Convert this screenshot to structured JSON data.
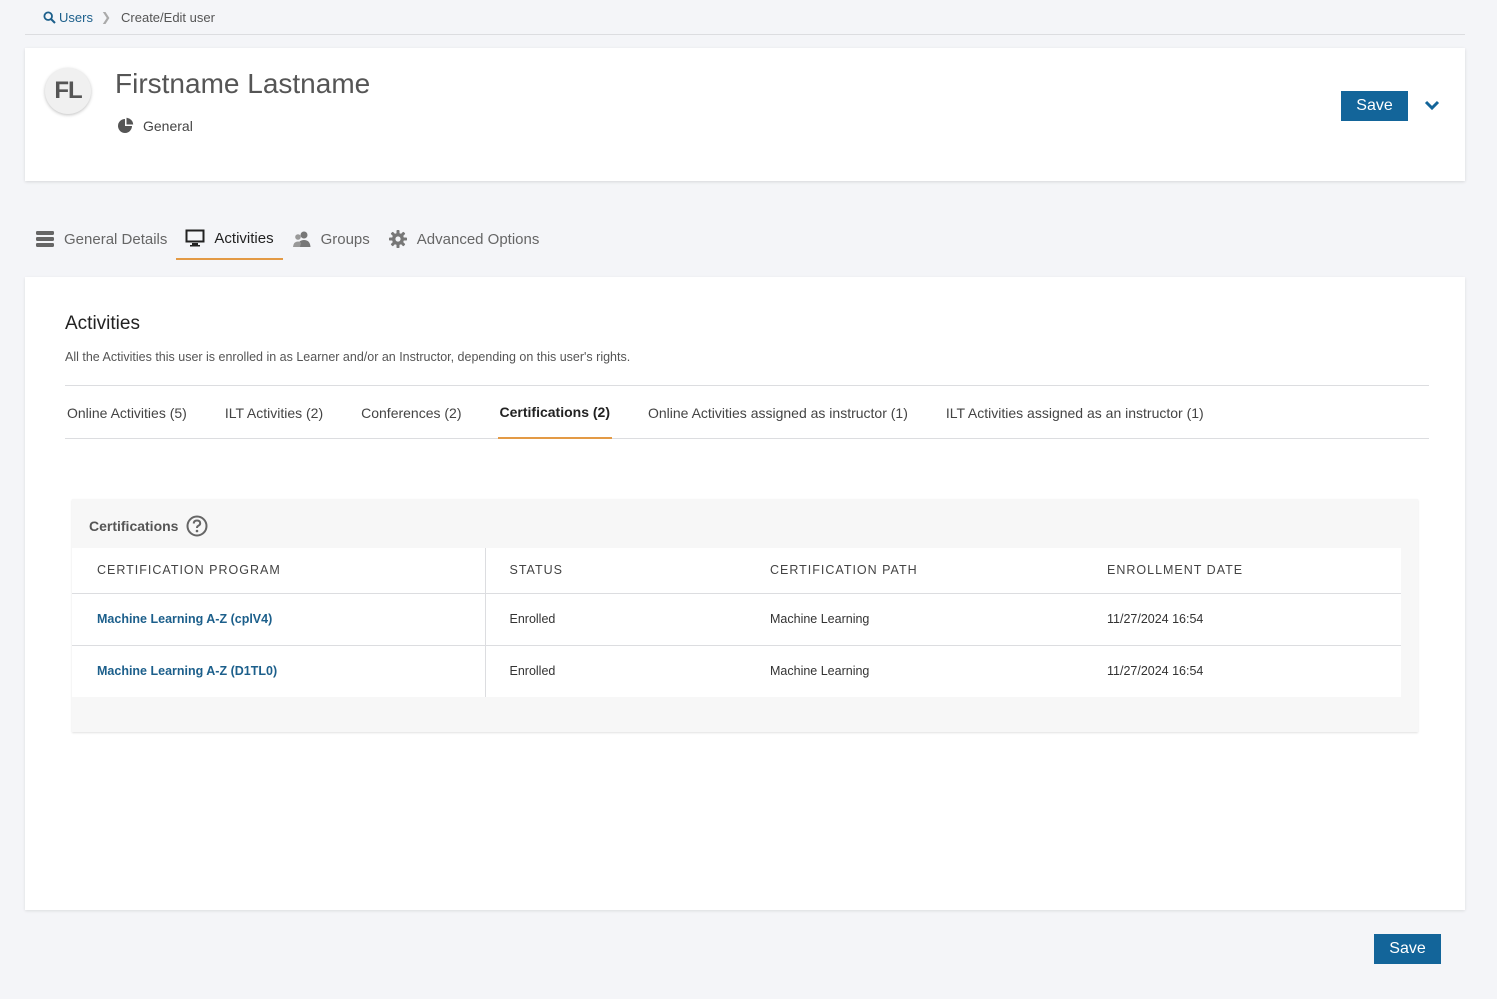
{
  "breadcrumb": {
    "root": "Users",
    "current": "Create/Edit user"
  },
  "user": {
    "initials": "FL",
    "name": "Firstname Lastname",
    "type": "General"
  },
  "actions": {
    "save_label": "Save"
  },
  "main_tabs": [
    {
      "label": "General Details",
      "icon": "list-icon"
    },
    {
      "label": "Activities",
      "icon": "monitor-icon",
      "active": true
    },
    {
      "label": "Groups",
      "icon": "users-icon"
    },
    {
      "label": "Advanced Options",
      "icon": "gear-icon"
    }
  ],
  "activities": {
    "title": "Activities",
    "description": "All the Activities this user is enrolled in as Learner and/or an Instructor, depending on this user's rights.",
    "sub_tabs": [
      {
        "label": "Online Activities (5)"
      },
      {
        "label": "ILT Activities (2)"
      },
      {
        "label": "Conferences (2)"
      },
      {
        "label": "Certifications (2)",
        "active": true
      },
      {
        "label": "Online Activities assigned as instructor (1)"
      },
      {
        "label": "ILT Activities assigned as an instructor (1)"
      }
    ]
  },
  "certifications": {
    "title": "Certifications",
    "columns": [
      "CERTIFICATION PROGRAM",
      "STATUS",
      "CERTIFICATION PATH",
      "ENROLLMENT DATE"
    ],
    "rows": [
      {
        "program": "Machine Learning A-Z (cplV4)",
        "status": "Enrolled",
        "path": "Machine Learning",
        "date": "11/27/2024 16:54"
      },
      {
        "program": "Machine Learning A-Z (D1TL0)",
        "status": "Enrolled",
        "path": "Machine Learning",
        "date": "11/27/2024 16:54"
      }
    ]
  },
  "colors": {
    "accent": "#13659a",
    "tab_underline": "#e39a45",
    "link": "#1c5f8b"
  }
}
